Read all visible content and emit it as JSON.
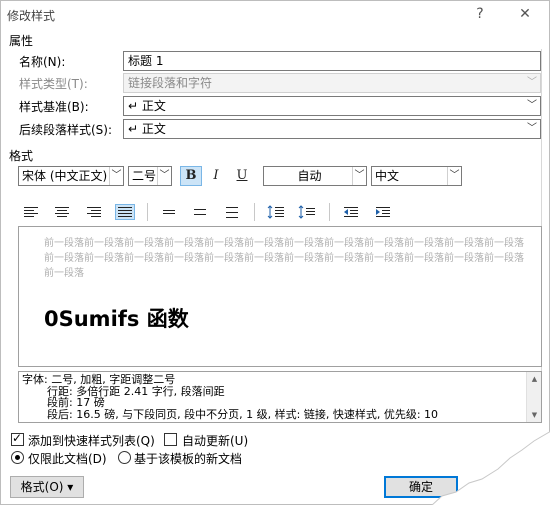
{
  "title": "修改样式",
  "titlebar": {
    "help": "?",
    "close": "✕"
  },
  "properties": {
    "section": "属性",
    "name_label": "名称(N):",
    "name_value": "标题 1",
    "type_label": "样式类型(T):",
    "type_value": "链接段落和字符",
    "base_label": "样式基准(B):",
    "base_value": "↵ 正文",
    "next_label": "后续段落样式(S):",
    "next_value": "↵ 正文"
  },
  "format": {
    "section": "格式",
    "font": "宋体 (中文正文)",
    "size": "二号",
    "bold": "B",
    "italic": "I",
    "underline": "U",
    "color": "自动",
    "language": "中文"
  },
  "preview": {
    "prev_text": "前一段落前一段落前一段落前一段落前一段落前一段落前一段落前一段落前一段落前一段落前一段落前一段落前一段落前一段落前一段落前一段落前一段落前一段落前一段落前一段落前一段落前一段落前一段落前一段落前一段落",
    "sample": "0Sumifs 函数"
  },
  "description": {
    "lines": [
      "字体: 二号, 加粗, 字距调整二号",
      "行距: 多倍行距 2.41 字行, 段落间距",
      "段前: 17 磅",
      "段后: 16.5 磅, 与下段同页, 段中不分页, 1 级, 样式: 链接, 快速样式, 优先级: 10"
    ]
  },
  "options": {
    "add_quick": "添加到快速样式列表(Q)",
    "auto_update": "自动更新(U)",
    "only_doc": "仅限此文档(D)",
    "template": "基于该模板的新文档"
  },
  "buttons": {
    "format": "格式(O) ▾",
    "ok": "确定"
  }
}
